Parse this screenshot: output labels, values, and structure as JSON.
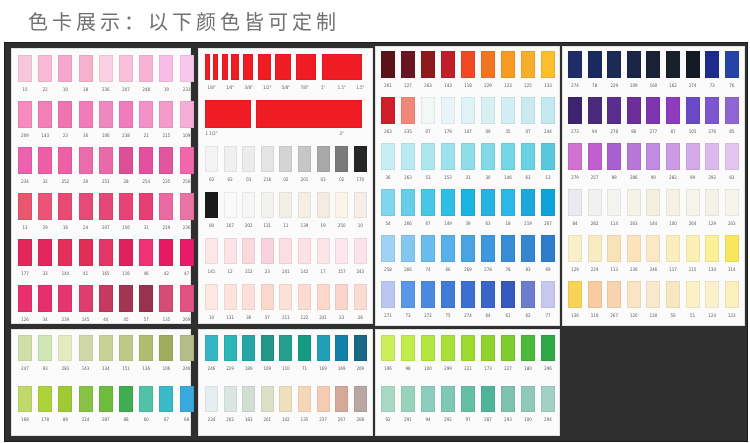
{
  "header": {
    "title": "色卡展示：以下颜色皆可定制"
  },
  "panels": [
    {
      "name": "pink-panel",
      "rows": [
        {
          "colors": [
            "#f9c7dc",
            "#f8b9d5",
            "#f6a8cc",
            "#f7b1cf",
            "#fcd0e4",
            "#f9c0dc",
            "#f6b3d6",
            "#f7bde4",
            "#f8c8ec"
          ],
          "codes": [
            "15",
            "22",
            "10",
            "18",
            "236",
            "207",
            "248",
            "19",
            "233"
          ]
        },
        {
          "colors": [
            "#f48cbf",
            "#f27fb7",
            "#f073b2",
            "#f27cb9",
            "#f088c0",
            "#ef7cbc",
            "#f491c8",
            "#f59bcb",
            "#f7aed6"
          ],
          "codes": [
            "209",
            "143",
            "23",
            "30",
            "106",
            "238",
            "21",
            "215",
            "109"
          ]
        },
        {
          "colors": [
            "#ea63ae",
            "#ed5ea6",
            "#ee5fa5",
            "#ea6cac",
            "#e96aa8",
            "#dc4f97",
            "#e64fa0",
            "#e2559f",
            "#f266ad"
          ],
          "codes": [
            "234",
            "32",
            "252",
            "30",
            "253",
            "28",
            "254",
            "235",
            "256"
          ]
        },
        {
          "colors": [
            "#e9566d",
            "#ec5477",
            "#e94a72",
            "#e74a78",
            "#e44879",
            "#e64477",
            "#e53f73",
            "#e96aa0",
            "#e874a5"
          ],
          "codes": [
            "13",
            "29",
            "16",
            "24",
            "207",
            "156",
            "31",
            "219",
            "236"
          ]
        },
        {
          "colors": [
            "#e2275b",
            "#e5265c",
            "#e33059",
            "#e02e57",
            "#e43567",
            "#e0205d",
            "#ee3275",
            "#e61a64",
            "#e61c69"
          ],
          "codes": [
            "177",
            "33",
            "144",
            "41",
            "165",
            "116",
            "46",
            "42",
            "47"
          ]
        },
        {
          "colors": [
            "#e8306e",
            "#e42f6c",
            "#e5376f",
            "#de3d6f",
            "#c63a5f",
            "#a23553",
            "#983250",
            "#d44c77",
            "#e25284"
          ],
          "codes": [
            "126",
            "34",
            "239",
            "145",
            "44",
            "45",
            "57",
            "135",
            "269"
          ]
        }
      ]
    },
    {
      "name": "green-panel",
      "rows": [
        {
          "colors": [
            "#cfe0a8",
            "#cee7b5",
            "#e4ecbf",
            "#d0d8a8",
            "#c7d394",
            "#bfc987",
            "#b0bd6c",
            "#a0ae5c",
            "#b6bc88"
          ],
          "codes": [
            "247",
            "93",
            "283",
            "143",
            "134",
            "151",
            "136",
            "106",
            "246"
          ]
        },
        {
          "colors": [
            "#c1d96a",
            "#aed23a",
            "#9fca34",
            "#88c244",
            "#6ebd3f",
            "#41ad51",
            "#50c2a6",
            "#3cb9c9",
            "#3aa9de"
          ],
          "codes": [
            "168",
            "178",
            "89",
            "224",
            "287",
            "88",
            "60",
            "67",
            "68"
          ]
        }
      ]
    },
    {
      "name": "red-white-panel",
      "rows": [
        {
          "colors": [
            "#ef1c24",
            "#ef1c24",
            "#ef1c24",
            "#ef1c24",
            "#ef1c24",
            "#ef1c24",
            "#ef1c24",
            "#ef1c24",
            "#ef1c24"
          ],
          "codes": [
            "1/8\"",
            "1/4\"",
            "3/8\"",
            "1/2\"",
            "5/8\"",
            "7/8\"",
            "1\"",
            "1.5\"",
            "1.5\""
          ]
        },
        {
          "colors": [
            "#ef1c24",
            "#ef1c24",
            "#ef1c24",
            "#ef1c24",
            "#ef1c24",
            "#ef1c24",
            "#ef1c24",
            "#ef1c24",
            "#ef1c24"
          ],
          "codes": [
            "1 1/2\"",
            "",
            "",
            "",
            "",
            "",
            "",
            "3\"",
            ""
          ]
        },
        {
          "colors": [
            "#f4f4f4",
            "#f0f0f0",
            "#ececec",
            "#e4e4e4",
            "#d4d4d4",
            "#c6c6c6",
            "#a8a8a8",
            "#7a7a7a",
            "#262626"
          ],
          "codes": [
            "03",
            "02",
            "03",
            "218",
            "02",
            "201",
            "03",
            "02",
            "170"
          ]
        },
        {
          "colors": [
            "#1a1a1a",
            "#fafafa",
            "#f6f6f6",
            "#f4f2ee",
            "#f2efe8",
            "#f5eee4",
            "#f3ece2",
            "#fbf4ea",
            "#f5ede6"
          ],
          "codes": [
            "00",
            "167",
            "202",
            "131",
            "11",
            "139",
            "19",
            "250",
            "10"
          ]
        },
        {
          "colors": [
            "#fde6ea",
            "#fbe3e6",
            "#fad8dc",
            "#f8d3dd",
            "#fcdde4",
            "#fce1e6",
            "#fbe5e8",
            "#fbe7ec",
            "#fde2ea"
          ],
          "codes": [
            "141",
            "12",
            "152",
            "23",
            "241",
            "142",
            "17",
            "157",
            "243"
          ]
        },
        {
          "colors": [
            "#fde8e3",
            "#fde3dc",
            "#fcdfd6",
            "#fbd8ce",
            "#fbe2d8",
            "#fcdcd2",
            "#fbd7cc",
            "#fad5cb",
            "#fbdcd3"
          ],
          "codes": [
            "10",
            "131",
            "36",
            "37",
            "211",
            "122",
            "241",
            "23",
            "28"
          ]
        }
      ]
    },
    {
      "name": "cyan-panel",
      "rows": [
        {
          "colors": [
            "#37b5c5",
            "#2ab7b7",
            "#24a6a6",
            "#21978a",
            "#23a08b",
            "#129c82",
            "#1f9fb8",
            "#127fa9",
            "#176887"
          ],
          "codes": [
            "246",
            "229",
            "189",
            "109",
            "110",
            "71",
            "169",
            "169",
            "209"
          ]
        },
        {
          "colors": [
            "#e7eef0",
            "#dbe6e4",
            "#d1dfd3",
            "#dbe0c8",
            "#eedfbd",
            "#f6d6b8",
            "#f5ccb3",
            "#d4a99a",
            "#b9a8a1"
          ],
          "codes": [
            "234",
            "202",
            "183",
            "201",
            "142",
            "135",
            "237",
            "267",
            "208"
          ]
        }
      ]
    },
    {
      "name": "red-blue-panel",
      "rows": [
        {
          "colors": [
            "#5b1318",
            "#6a1622",
            "#8e1a1c",
            "#c01e2a",
            "#ef4a24",
            "#f27523",
            "#f69b22",
            "#f7ae2a",
            "#fbbf2c"
          ],
          "codes": [
            "261",
            "127",
            "263",
            "143",
            "118",
            "229",
            "123",
            "125",
            "133"
          ]
        },
        {
          "colors": [
            "#ce1f2a",
            "#f18778",
            "#f2f7f8",
            "#e8f5f8",
            "#dff3f6",
            "#d6f0f4",
            "#d1eef2",
            "#cbeaf1",
            "#c4e8ef"
          ],
          "codes": [
            "263",
            "235",
            "07",
            "179",
            "147",
            "09",
            "35",
            "07",
            "244"
          ]
        },
        {
          "colors": [
            "#c7eef5",
            "#b9e9f2",
            "#ade6f0",
            "#9ce2ee",
            "#8edeea",
            "#82dae8",
            "#72d6e4",
            "#6ad2e2",
            "#5ac8dc"
          ],
          "codes": [
            "36",
            "263",
            "53",
            "153",
            "31",
            "30",
            "146",
            "63",
            "13"
          ]
        },
        {
          "colors": [
            "#7fd6ee",
            "#65cfea",
            "#46c7e6",
            "#2dbfe4",
            "#1ab5e0",
            "#27b3e2",
            "#2cb7e6",
            "#1ca9de",
            "#0ea3db"
          ],
          "codes": [
            "54",
            "266",
            "67",
            "149",
            "39",
            "63",
            "18",
            "219",
            "267"
          ]
        },
        {
          "colors": [
            "#9fd2f3",
            "#83c7f0",
            "#69bcec",
            "#57b1e8",
            "#4ba4e2",
            "#3c97dc",
            "#388cd6",
            "#3587d1",
            "#2f7ccb"
          ],
          "codes": [
            "258",
            "266",
            "74",
            "66",
            "269",
            "278",
            "78",
            "83",
            "69"
          ]
        },
        {
          "colors": [
            "#b9c7f1",
            "#5b97e8",
            "#4b88e0",
            "#3f7bd7",
            "#3b6fd0",
            "#3a64c8",
            "#3758bd",
            "#6d7ccc",
            "#c8c8ef"
          ],
          "codes": [
            "271",
            "73",
            "272",
            "75",
            "274",
            "64",
            "61",
            "62",
            "77"
          ]
        }
      ]
    },
    {
      "name": "lime-panel",
      "rows": [
        {
          "colors": [
            "#cbef5a",
            "#c0ec4c",
            "#b5e63d",
            "#a7e037",
            "#9cda30",
            "#8fd42c",
            "#7dcb2c",
            "#4ab838",
            "#2ea844"
          ],
          "codes": [
            "196",
            "98",
            "100",
            "299",
            "221",
            "173",
            "227",
            "180",
            "296"
          ]
        },
        {
          "colors": [
            "#a9d9c5",
            "#97d3bd",
            "#8ccdbd",
            "#7fc8b3",
            "#66bea5",
            "#50b49a",
            "#7ec2b0",
            "#8fc9b9",
            "#a3d0c5"
          ],
          "codes": [
            "92",
            "291",
            "94",
            "292",
            "97",
            "287",
            "293",
            "100",
            "294"
          ]
        }
      ]
    },
    {
      "name": "purple-yellow-panel",
      "rows": [
        {
          "colors": [
            "#1f2e6b",
            "#1a2a5e",
            "#1b2a56",
            "#1b2547",
            "#1a2036",
            "#19202c",
            "#151b24",
            "#1d2b8d",
            "#2644a8"
          ],
          "codes": [
            "274",
            "78",
            "229",
            "109",
            "160",
            "162",
            "274",
            "73",
            "76"
          ]
        },
        {
          "colors": [
            "#3c2470",
            "#4b2a7c",
            "#5a2e8e",
            "#6d2e9a",
            "#7e36b0",
            "#8e3cbd",
            "#6b4ac6",
            "#7d55cf",
            "#9065d4"
          ],
          "codes": [
            "273",
            "94",
            "278",
            "86",
            "277",
            "87",
            "105",
            "276",
            "85"
          ]
        },
        {
          "colors": [
            "#cf72d2",
            "#c25fd0",
            "#a95ed2",
            "#b677d9",
            "#c08be0",
            "#cc9be3",
            "#d3abe8",
            "#dcb8ec",
            "#e2c6f0"
          ],
          "codes": [
            "279",
            "257",
            "89",
            "286",
            "90",
            "282",
            "99",
            "292",
            "83"
          ]
        },
        {
          "colors": [
            "#ebeaef",
            "#f1f1f1",
            "#f4f3ee",
            "#f5f3e6",
            "#f4f0e0",
            "#f6f1e4",
            "#f6f3ea",
            "#f5f3e8",
            "#f6f4ec"
          ],
          "codes": [
            "84",
            "282",
            "114",
            "263",
            "144",
            "100",
            "264",
            "129",
            "203"
          ]
        },
        {
          "colors": [
            "#f9f0c9",
            "#f9ebc2",
            "#f9e2b6",
            "#fbe3bb",
            "#fbe8c5",
            "#fbeebd",
            "#fbf0b4",
            "#fbef98",
            "#f8e65c"
          ],
          "codes": [
            "129",
            "229",
            "113",
            "236",
            "246",
            "117",
            "115",
            "130",
            "114"
          ]
        },
        {
          "colors": [
            "#f8d456",
            "#f9cba0",
            "#f8d3ad",
            "#fae4c4",
            "#f9e9cd",
            "#f8e8c1",
            "#faf1c4",
            "#fbf2cd",
            "#fbefbc"
          ],
          "codes": [
            "136",
            "119",
            "267",
            "120",
            "130",
            "50",
            "51",
            "124",
            "123"
          ]
        }
      ]
    }
  ]
}
